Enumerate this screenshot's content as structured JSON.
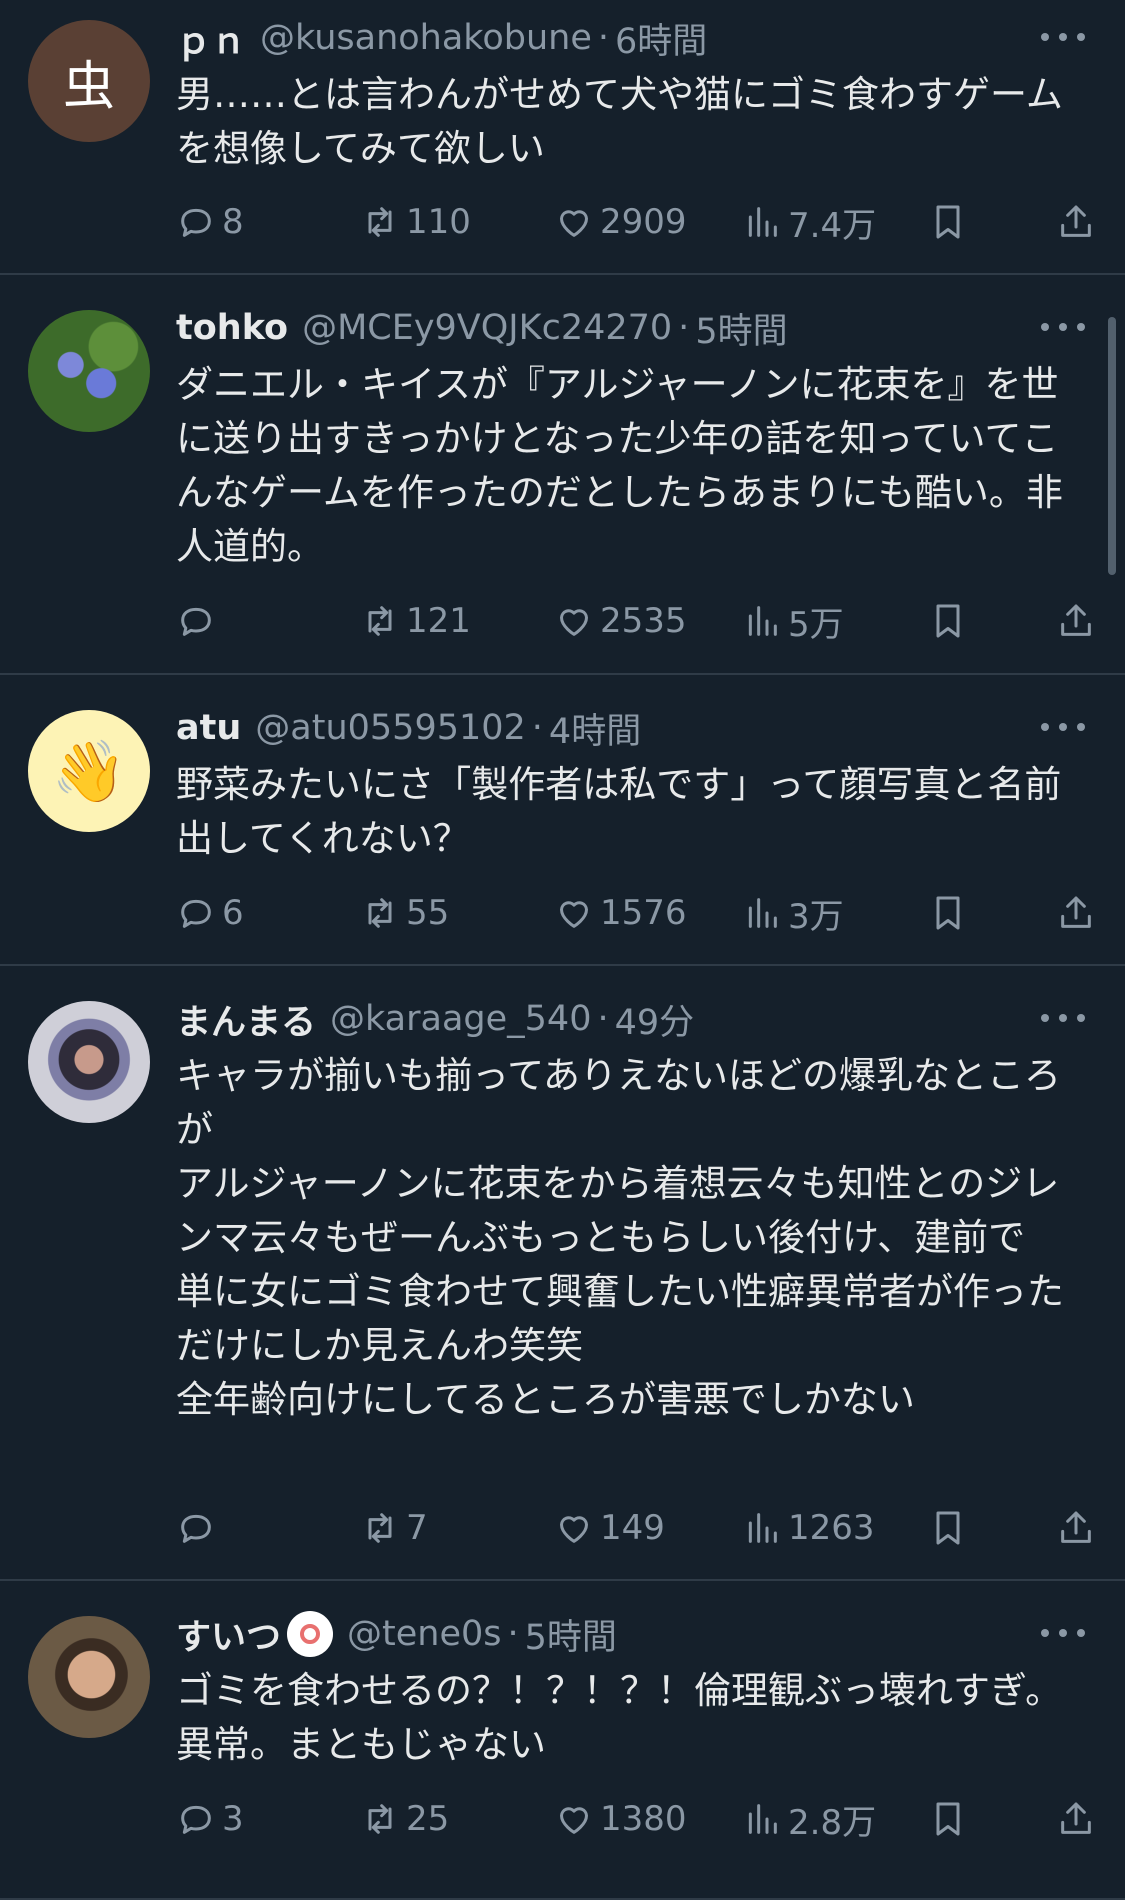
{
  "colors": {
    "background": "#15202b",
    "divider": "#2f3b47",
    "text_primary": "#e7e9ea",
    "text_secondary": "#8b98a5"
  },
  "icons": {
    "reply": "reply-icon",
    "repost": "repost-icon",
    "like": "heart-icon",
    "views": "views-icon",
    "bookmark": "bookmark-icon",
    "share": "share-icon",
    "more": "more-icon"
  },
  "tweets": [
    {
      "avatar_glyph": "虫",
      "avatar_color": "#5a4034",
      "name": "ｐｎ",
      "handle": "@kusanohakobune",
      "separator": "·",
      "time": "6時間",
      "text": "男……とは言わんがせめて犬や猫にゴミ食わすゲームを想像してみて欲しい",
      "replies": "8",
      "reposts": "110",
      "likes": "2909",
      "views": "7.4万"
    },
    {
      "avatar_glyph": "",
      "avatar_color": "#3d6b2a",
      "name": "tohko",
      "handle": "@MCEy9VQJKc24270",
      "separator": "·",
      "time": "5時間",
      "text": "ダニエル・キイスが『アルジャーノンに花束を』を世に送り出すきっかけとなった少年の話を知っていてこんなゲームを作ったのだとしたらあまりにも酷い。非人道的。",
      "replies": "",
      "reposts": "121",
      "likes": "2535",
      "views": "5万"
    },
    {
      "avatar_glyph": "👋",
      "avatar_color": "#fdf3b5",
      "name": "atu",
      "handle": "@atu05595102",
      "separator": "·",
      "time": "4時間",
      "text": "野菜みたいにさ「製作者は私です」って顔写真と名前出してくれない？",
      "replies": "6",
      "reposts": "55",
      "likes": "1576",
      "views": "3万"
    },
    {
      "avatar_glyph": "",
      "avatar_color": "#cfcfd8",
      "name": "まんまる",
      "handle": "@karaage_540",
      "separator": "·",
      "time": "49分",
      "text": "キャラが揃いも揃ってありえないほどの爆乳なところが\nアルジャーノンに花束をから着想云々も知性とのジレンマ云々もぜーんぶもっともらしい後付け、建前で\n単に女にゴミ食わせて興奮したい性癖異常者が作っただけにしか見えんわ笑笑\n全年齢向けにしてるところが害悪でしかない",
      "replies": "",
      "reposts": "7",
      "likes": "149",
      "views": "1263"
    },
    {
      "avatar_glyph": "",
      "avatar_color": "#5b4a3a",
      "name": "すいつ",
      "handle": "@tene0s",
      "separator": "·",
      "time": "5時間",
      "text": "ゴミを食わせるの？！？！？！倫理観ぶっ壊れすぎ。異常。まともじゃない",
      "replies": "3",
      "reposts": "25",
      "likes": "1380",
      "views": "2.8万"
    }
  ]
}
